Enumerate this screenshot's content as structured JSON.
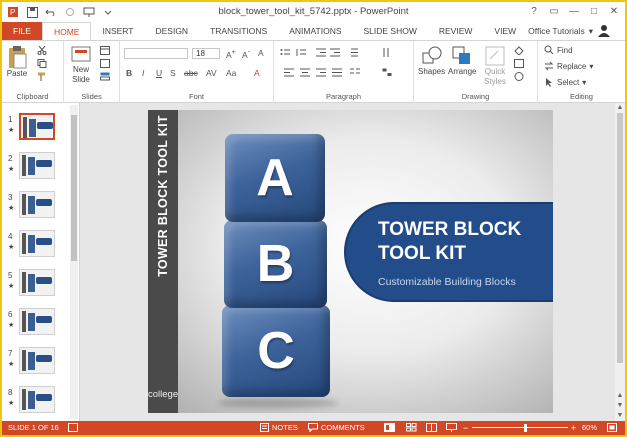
{
  "window": {
    "title": "block_tower_tool_kit_5742.pptx - PowerPoint",
    "controls": [
      "?",
      "▭",
      "—",
      "□",
      "✕"
    ]
  },
  "tabs": [
    {
      "label": "FILE",
      "type": "file"
    },
    {
      "label": "HOME",
      "type": "active"
    },
    {
      "label": "INSERT"
    },
    {
      "label": "DESIGN"
    },
    {
      "label": "TRANSITIONS"
    },
    {
      "label": "ANIMATIONS"
    },
    {
      "label": "SLIDE SHOW"
    },
    {
      "label": "REVIEW"
    },
    {
      "label": "VIEW"
    }
  ],
  "account": {
    "name": "Office Tutorials"
  },
  "ribbon": {
    "clipboard": {
      "label": "Clipboard",
      "paste": "Paste"
    },
    "slides": {
      "label": "Slides",
      "new_slide": "New Slide"
    },
    "font": {
      "label": "Font",
      "size": "18"
    },
    "paragraph": {
      "label": "Paragraph"
    },
    "drawing": {
      "label": "Drawing",
      "shapes": "Shapes",
      "arrange": "Arrange",
      "quick_styles": "Quick Styles"
    },
    "editing": {
      "label": "Editing",
      "find": "Find",
      "replace": "Replace",
      "select": "Select"
    }
  },
  "thumbnails": [
    {
      "number": "1",
      "star": "★",
      "selected": true
    },
    {
      "number": "2",
      "star": "★"
    },
    {
      "number": "3",
      "star": "★"
    },
    {
      "number": "4",
      "star": "★"
    },
    {
      "number": "5",
      "star": "★"
    },
    {
      "number": "6",
      "star": "★"
    },
    {
      "number": "7",
      "star": "★"
    },
    {
      "number": "8",
      "star": "★"
    }
  ],
  "slide": {
    "vertical_title": "TOWER BLOCK TOOL KIT",
    "cube_letters": [
      "A",
      "B",
      "C"
    ],
    "title": "TOWER BLOCK TOOL KIT",
    "subtitle": "Customizable Building Blocks",
    "watermark": "college"
  },
  "status": {
    "slide_indicator": "SLIDE 1 OF 16",
    "notes": "NOTES",
    "comments": "COMMENTS",
    "zoom": "60%",
    "zoom_fraction": 0.55
  },
  "colors": {
    "accent": "#d24726",
    "cube": "#3d639b",
    "title_box": "#234d8a",
    "band": "#4a4a4a"
  }
}
